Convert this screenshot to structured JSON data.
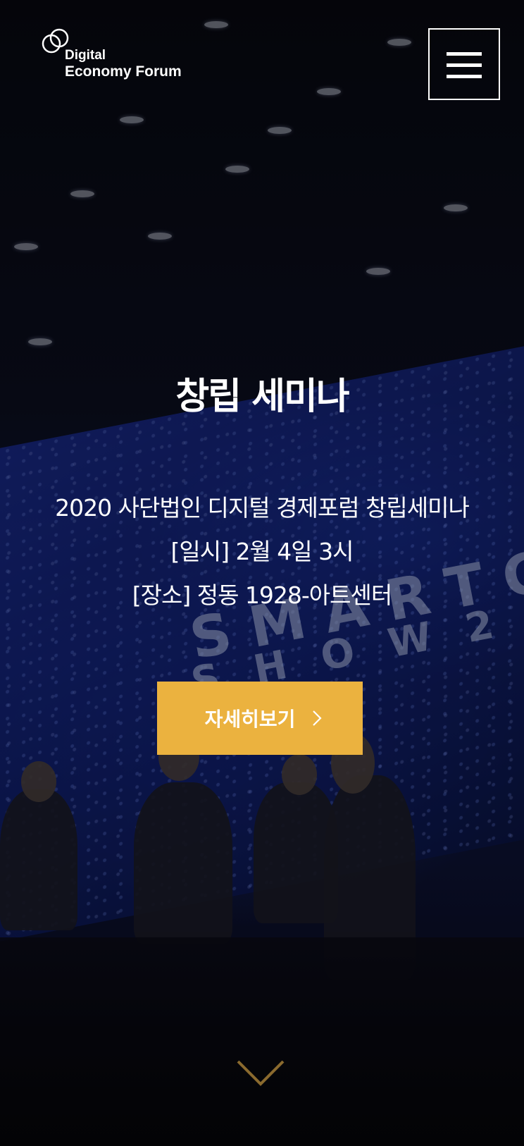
{
  "header": {
    "logo_line1": "Digital",
    "logo_line2": "Economy Forum",
    "menu_icon": "hamburger-menu-icon"
  },
  "hero": {
    "title": "창립 세미나",
    "description": [
      "2020 사단법인 디지털 경제포럼 창립세미나",
      "[일시] 2월 4일 3시",
      "[장소] 정동 1928-아트센터"
    ],
    "background_screen_text": [
      "SMARTC",
      "SHOW2"
    ],
    "cta_label": "자세히보기",
    "cta_icon": "chevron-right-icon",
    "scroll_icon": "chevron-down-icon"
  },
  "colors": {
    "accent": "#EBB23F",
    "text": "#FFFFFF"
  }
}
